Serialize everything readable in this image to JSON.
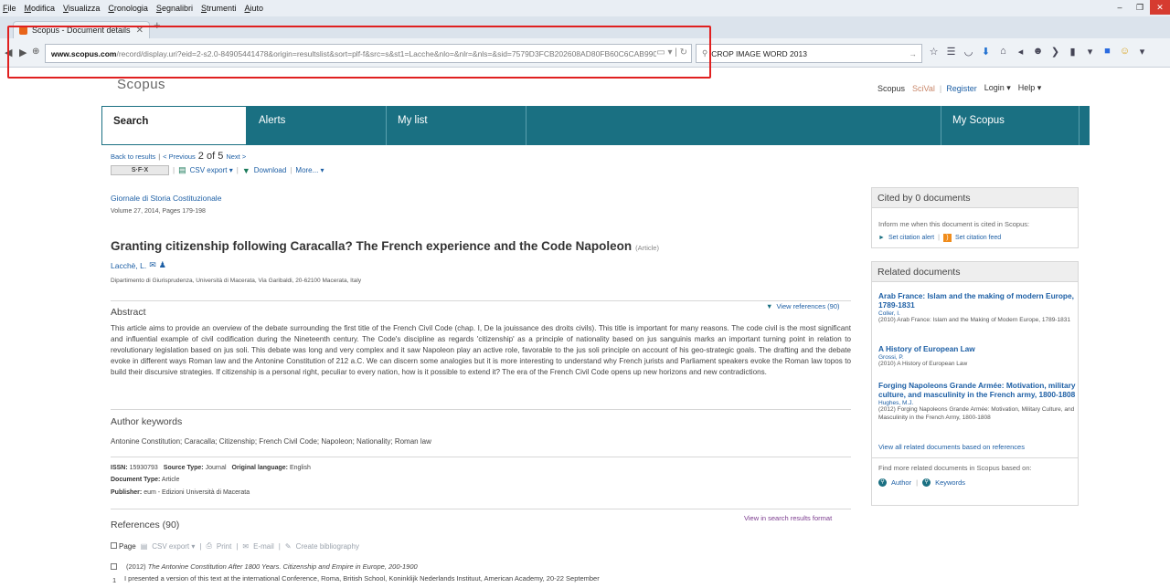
{
  "browser": {
    "menu": [
      "File",
      "Modifica",
      "Visualizza",
      "Cronologia",
      "Segnalibri",
      "Strumenti",
      "Aiuto"
    ],
    "tab_title": "Scopus - Document details",
    "url_domain": "www.scopus.com",
    "url_rest": "/record/display.uri?eid=2-s2.0-84905441478&origin=resultslist&sort=plf-f&src=s&st1=Lacche&nlo=&nlr=&nls=&sid=7579D3FCB202608AD80FB60C6CAB9903",
    "search_value": "CROP IMAGE WORD 2013",
    "min_label": "–",
    "restore_label": "❐"
  },
  "header": {
    "logo": "Scopus",
    "links": {
      "scopus": "Scopus",
      "scival": "SciVal",
      "register": "Register",
      "login": "Login ▾",
      "help": "Help ▾"
    }
  },
  "nav": {
    "tabs": [
      "Search",
      "Alerts",
      "My list",
      "My Scopus"
    ]
  },
  "results_nav": {
    "back": "Back to results",
    "previous": "< Previous",
    "position": "2 of 5",
    "next": "Next >"
  },
  "actions": {
    "sfx": "S·F·X",
    "csv": "CSV export ▾",
    "download": "Download",
    "more": "More... ▾"
  },
  "article": {
    "journal": "Giornale di Storia Costituzionale",
    "volume": "Volume 27, 2014, Pages 179-198",
    "title": "Granting citizenship following Caracalla? The French experience and the Code Napoleon",
    "type": "(Article)",
    "author": "Lacchè, L.",
    "affiliation": "Dipartimento di Giurisprudenza, Università di Macerata, Via Garibaldi, 20-62100 Macerata, Italy",
    "abstract_heading": "Abstract",
    "view_references": "View references (90)",
    "abstract": "This article aims to provide an overview of the debate surrounding the first title of the French Civil Code (chap. I, De la jouissance des droits civils). This title is important for many reasons. The code civil is the most significant and influential example of civil codification during the Nineteenth century. The Code's discipline as regards 'citizenship' as a principle of nationality based on jus sanguinis marks an important turning point in relation to revolutionary legislation based on jus soli. This debate was long and very complex and it saw Napoleon play an active role, favorable to the jus soli principle on account of his geo-strategic goals. The drafting and the debate evoke in different ways Roman law and the Antonine Constitution of 212 a.C. We can discern some analogies but it is more interesting to understand why French jurists and Parliament speakers evoke the Roman law topos to build their discursive strategies. If citizenship is a personal right, peculiar to every nation, how is it possible to extend it? The era of the French Civil Code opens up new horizons and new contradictions.",
    "keywords_heading": "Author keywords",
    "keywords": "Antonine Constitution; Caracalla; Citizenship; French Civil Code; Napoleon; Nationality; Roman law",
    "issn_label": "ISSN:",
    "issn": "15930793",
    "source_type_label": "Source Type:",
    "source_type": "Journal",
    "language_label": "Original language:",
    "language": "English",
    "doc_type_label": "Document Type:",
    "doc_type": "Article",
    "publisher_label": "Publisher:",
    "publisher": "eum - Edizioni Università di Macerata"
  },
  "references": {
    "heading": "References (90)",
    "view_search": "View in search results format",
    "tools": {
      "page": "Page",
      "csv": "CSV export ▾",
      "print": "Print",
      "email": "E-mail",
      "bibliography": "Create bibliography"
    },
    "first": {
      "year": "(2012)",
      "title": "The Antonine Constitution After 1800 Years. Citizenship and Empire in Europe, 200-1900",
      "num": "1",
      "note": "I presented a version of this text at the international Conference, Roma, British School, Koninklijk Nederlands Instituut, American Academy, 20-22 September"
    }
  },
  "cited": {
    "heading": "Cited by 0 documents",
    "message": "Inform me when this document is cited in Scopus:",
    "alert": "Set citation alert",
    "feed": "Set citation feed"
  },
  "related": {
    "heading": "Related documents",
    "items": [
      {
        "title": "Arab France: Islam and the making of modern Europe, 1789-1831",
        "author": "Coller, I.",
        "source": "(2010) Arab France: Islam and the Making of Modern Europe, 1789-1831"
      },
      {
        "title": "A History of European Law",
        "author": "Grossi, P.",
        "source": "(2010) A History of European Law"
      },
      {
        "title": "Forging Napoleons Grande Armée: Motivation, military culture, and masculinity in the French army, 1800-1808",
        "author": "Hughes, M.J.",
        "source": "(2012) Forging Napoleons Grande Armée: Motivation, Military Culture, and Masculinity in the French Army, 1800-1808"
      }
    ],
    "view_all": "View all related documents based on references",
    "find_more": "Find more related documents in Scopus based on:",
    "author_link": "Author",
    "keywords_link": "Keywords"
  }
}
